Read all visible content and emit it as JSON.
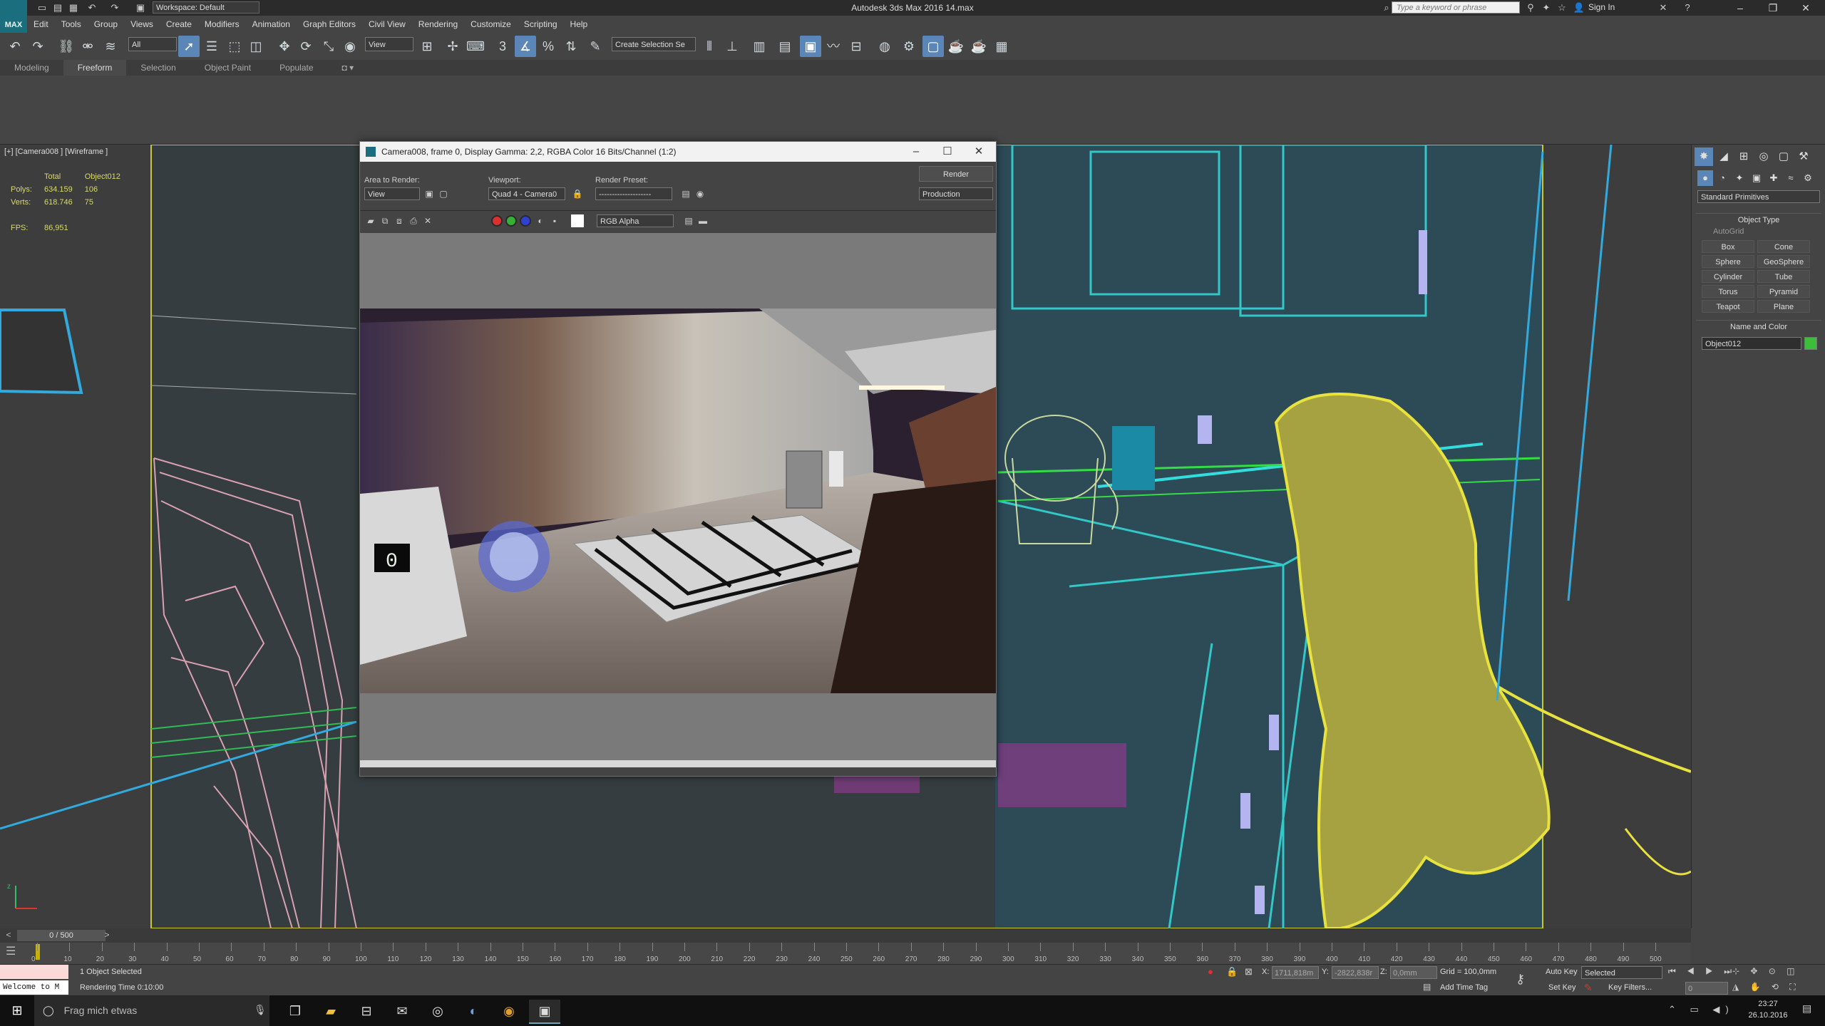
{
  "app": {
    "logo": "MAX",
    "workspace": "Workspace: Default",
    "title": "Autodesk 3ds Max 2016     14.max",
    "search_placeholder": "Type a keyword or phrase",
    "sign_in": "Sign In"
  },
  "menu": [
    "Edit",
    "Tools",
    "Group",
    "Views",
    "Create",
    "Modifiers",
    "Animation",
    "Graph Editors",
    "Civil View",
    "Rendering",
    "Customize",
    "Scripting",
    "Help"
  ],
  "toolbar": {
    "selection_filter": "All",
    "ref_coord": "View",
    "named_selection": "Create Selection Se"
  },
  "ribbon": {
    "tabs": [
      "Modeling",
      "Freeform",
      "Selection",
      "Object Paint",
      "Populate"
    ],
    "active_tab": "Freeform"
  },
  "viewport": {
    "label": "[+] [Camera008 ] [Wireframe ]",
    "stats": {
      "header_total": "Total",
      "header_object": "Object012",
      "polys_label": "Polys:",
      "polys_total": "634.159",
      "polys_object": "106",
      "verts_label": "Verts:",
      "verts_total": "618.746",
      "verts_object": "75",
      "fps_label": "FPS:",
      "fps_value": "86,951"
    },
    "axis_z": "z",
    "axis_x": "x"
  },
  "render_window": {
    "title": "Camera008, frame 0, Display Gamma: 2,2, RGBA Color 16 Bits/Channel (1:2)",
    "area_label": "Area to Render:",
    "area_value": "View",
    "viewport_label": "Viewport:",
    "viewport_value": "Quad 4 - Camera0",
    "preset_label": "Render Preset:",
    "preset_value": "--------------------",
    "render_button": "Render",
    "mode_value": "Production",
    "channel_value": "RGB Alpha"
  },
  "command_panel": {
    "category": "Standard Primitives",
    "object_type_title": "Object Type",
    "autogrid": "AutoGrid",
    "primitives": [
      "Box",
      "Cone",
      "Sphere",
      "GeoSphere",
      "Cylinder",
      "Tube",
      "Torus",
      "Pyramid",
      "Teapot",
      "Plane"
    ],
    "name_color_title": "Name and Color",
    "object_name": "Object012",
    "object_color": "#3cbd3c"
  },
  "timeline": {
    "frame_counter": "0 / 500",
    "ticks": [
      "0",
      "10",
      "20",
      "30",
      "40",
      "50",
      "60",
      "70",
      "80",
      "90",
      "100",
      "110",
      "120",
      "130",
      "140",
      "150",
      "160",
      "170",
      "180",
      "190",
      "200",
      "210",
      "220",
      "230",
      "240",
      "250",
      "260",
      "270",
      "280",
      "290",
      "300",
      "310",
      "320",
      "330",
      "340",
      "350",
      "360",
      "370",
      "380",
      "390",
      "400",
      "410",
      "420",
      "430",
      "440",
      "450",
      "460",
      "470",
      "480",
      "490",
      "500"
    ]
  },
  "status": {
    "listener": "Welcome to M",
    "selected_text": "1 Object Selected",
    "render_time": "Rendering Time  0:10:00",
    "x_label": "X:",
    "x_value": "1711,818m",
    "y_label": "Y:",
    "y_value": "-2822,838r",
    "z_label": "Z:",
    "z_value": "0,0mm",
    "grid": "Grid = 100,0mm",
    "add_time_tag": "Add Time Tag",
    "auto_key": "Auto Key",
    "key_mode": "Selected",
    "set_key": "Set Key",
    "key_filters": "Key Filters...",
    "current_frame": "0"
  },
  "taskbar": {
    "search": "Frag mich etwas",
    "time": "23:27",
    "date": "26.10.2016"
  }
}
